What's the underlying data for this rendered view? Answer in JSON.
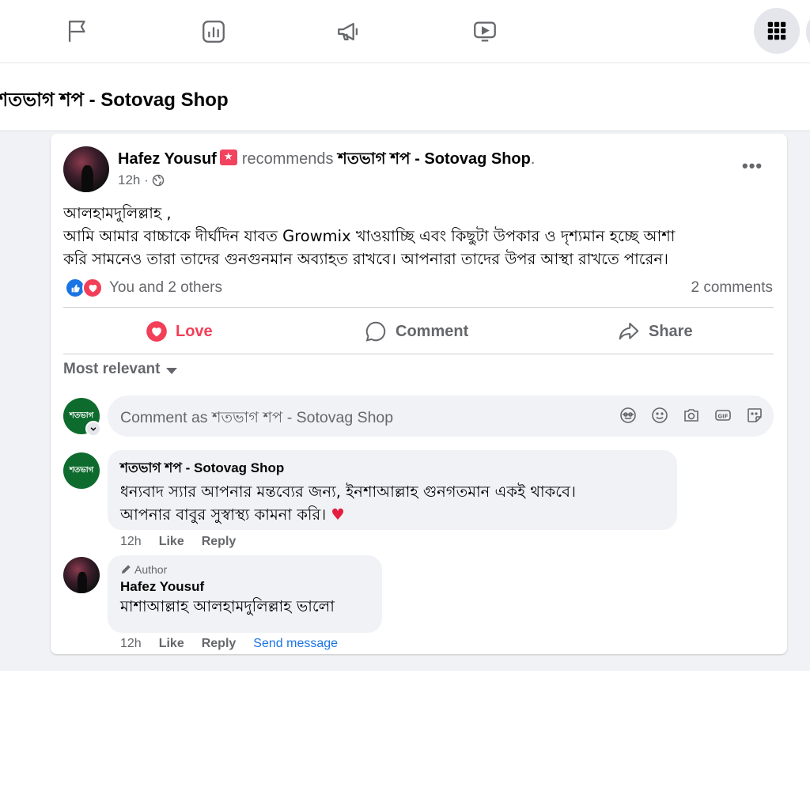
{
  "nav": {
    "icons": [
      "flag-icon",
      "analytics-icon",
      "megaphone-icon",
      "video-icon",
      "menu-grid-icon"
    ]
  },
  "page": {
    "title": "শতভাগ শপ - Sotovag Shop"
  },
  "post": {
    "author": "Hafez Yousuf",
    "recommends": "recommends",
    "page_name": "শতভাগ শপ - Sotovag Shop",
    "period": ".",
    "time": "12h ·",
    "more": "•••",
    "body": [
      "আলহামদুলিল্লাহ ,",
      "আমি আমার বাচ্চাকে দীর্ঘদিন যাবত Growmix খাওয়াচ্ছি এবং কিছুটা উপকার ও দৃশ্যমান হচ্ছে আশা",
      "করি সামনেও তারা তাদের গুনগুনমান অব্যাহত রাখবে। আপনারা তাদের উপর আস্থা রাখতে পারেন।"
    ],
    "reactions_text": "You and 2 others",
    "comments_count": "2 comments",
    "actions": {
      "love": "Love",
      "comment": "Comment",
      "share": "Share"
    },
    "sort_label": "Most relevant",
    "composer_placeholder": "Comment as শতভাগ শপ - Sotovag Shop",
    "avatar_label": "শতভাগ"
  },
  "comments": [
    {
      "author": "শতভাগ শপ - Sotovag Shop",
      "lines": [
        "ধন্যবাদ স্যার আপনার মন্তব্যের জন্য, ইনশাআল্লাহ গুনগতমান একই থাকবে।",
        "আপনার বাবুর সুস্বাস্থ্য কামনা করি।"
      ],
      "heart": "♥",
      "time": "12h",
      "like": "Like",
      "reply": "Reply"
    },
    {
      "tag": "Author",
      "author": "Hafez Yousuf",
      "lines": [
        "মাশাআল্লাহ আলহামদুলিল্লাহ ভালো"
      ],
      "time": "12h",
      "like": "Like",
      "reply": "Reply",
      "send": "Send message"
    }
  ],
  "colors": {
    "accent_blue": "#1b74e4",
    "love_red": "#f33e58",
    "muted_text": "#65676b",
    "feed_bg": "#f0f2f5",
    "page_avatar_green": "#0d6b2e"
  }
}
